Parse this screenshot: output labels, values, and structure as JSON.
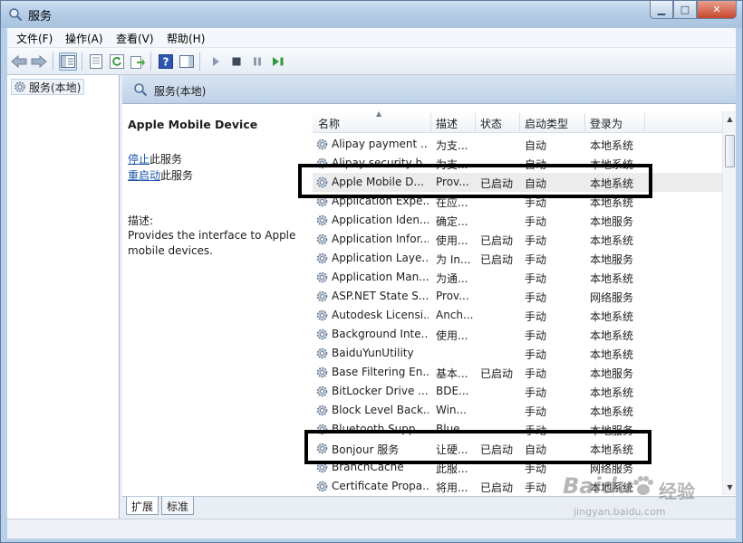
{
  "window": {
    "title": "服务"
  },
  "menu": [
    "文件(F)",
    "操作(A)",
    "查看(V)",
    "帮助(H)"
  ],
  "tree": {
    "root_label": "服务(本地)"
  },
  "pane_header": "服务(本地)",
  "selected_service": {
    "name": "Apple Mobile Device",
    "stop_link": "停止",
    "stop_suffix": "此服务",
    "restart_link": "重启动",
    "restart_suffix": "此服务",
    "desc_label": "描述:",
    "description": "Provides the interface to Apple mobile devices."
  },
  "columns": [
    "名称",
    "描述",
    "状态",
    "启动类型",
    "登录为"
  ],
  "rows": [
    {
      "name": "Alipay payment ...",
      "desc": "为支...",
      "status": "",
      "startup": "自动",
      "logon": "本地系统"
    },
    {
      "name": "Alipay security b...",
      "desc": "为支...",
      "status": "",
      "startup": "自动",
      "logon": "本地系统"
    },
    {
      "name": "Apple Mobile D...",
      "desc": "Prov...",
      "status": "已启动",
      "startup": "自动",
      "logon": "本地系统"
    },
    {
      "name": "Application Expe...",
      "desc": "在应...",
      "status": "",
      "startup": "手动",
      "logon": "本地系统"
    },
    {
      "name": "Application Iden...",
      "desc": "确定...",
      "status": "",
      "startup": "手动",
      "logon": "本地服务"
    },
    {
      "name": "Application Infor...",
      "desc": "使用...",
      "status": "已启动",
      "startup": "手动",
      "logon": "本地系统"
    },
    {
      "name": "Application Laye...",
      "desc": "为 In...",
      "status": "已启动",
      "startup": "手动",
      "logon": "本地服务"
    },
    {
      "name": "Application Man...",
      "desc": "为通...",
      "status": "",
      "startup": "手动",
      "logon": "本地系统"
    },
    {
      "name": "ASP.NET State S...",
      "desc": "Prov...",
      "status": "",
      "startup": "手动",
      "logon": "网络服务"
    },
    {
      "name": "Autodesk Licensi...",
      "desc": "Anch...",
      "status": "",
      "startup": "手动",
      "logon": "本地系统"
    },
    {
      "name": "Background Inte...",
      "desc": "使用...",
      "status": "",
      "startup": "手动",
      "logon": "本地系统"
    },
    {
      "name": "BaiduYunUtility",
      "desc": "",
      "status": "",
      "startup": "手动",
      "logon": "本地系统"
    },
    {
      "name": "Base Filtering En...",
      "desc": "基本...",
      "status": "已启动",
      "startup": "手动",
      "logon": "本地服务"
    },
    {
      "name": "BitLocker Drive ...",
      "desc": "BDE...",
      "status": "",
      "startup": "手动",
      "logon": "本地系统"
    },
    {
      "name": "Block Level Back...",
      "desc": "Win...",
      "status": "",
      "startup": "手动",
      "logon": "本地系统"
    },
    {
      "name": "Bluetooth Supp...",
      "desc": "Blue...",
      "status": "",
      "startup": "手动",
      "logon": "本地服务"
    },
    {
      "name": "Bonjour 服务",
      "desc": "让硬...",
      "status": "已启动",
      "startup": "自动",
      "logon": "本地系统"
    },
    {
      "name": "BranchCache",
      "desc": "此服...",
      "status": "",
      "startup": "手动",
      "logon": "网络服务"
    },
    {
      "name": "Certificate Propa...",
      "desc": "将用...",
      "status": "已启动",
      "startup": "手动",
      "logon": "本地系统"
    }
  ],
  "tabs": [
    "扩展",
    "标准"
  ],
  "watermark": {
    "logo": "Baidu",
    "suffix": "经验",
    "url": "jingyan.baidu.com"
  }
}
